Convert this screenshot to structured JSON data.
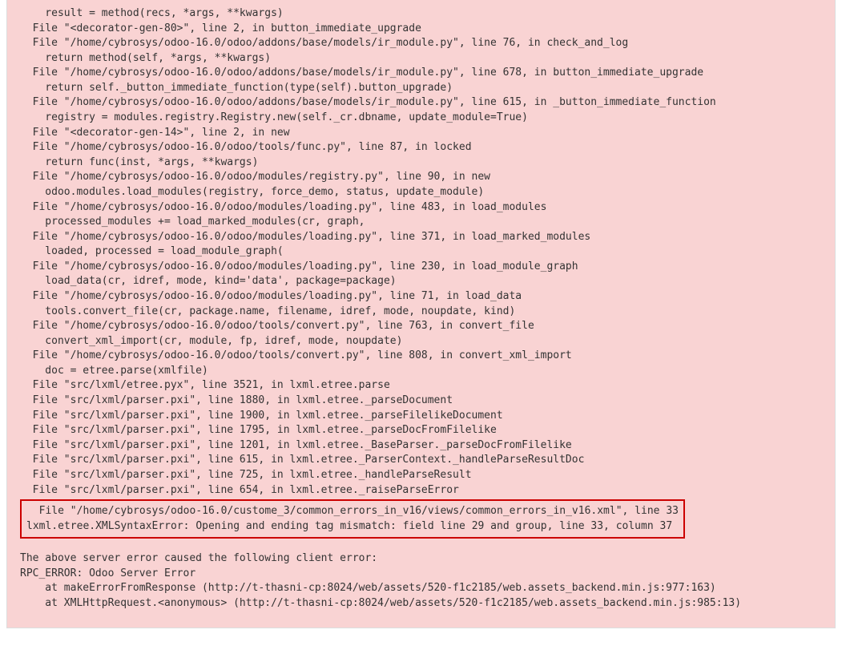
{
  "traceback": {
    "lines": [
      {
        "text": "    result = method(recs, *args, **kwargs)",
        "cls": "indent-1"
      },
      {
        "text": "  File \"<decorator-gen-80>\", line 2, in button_immediate_upgrade",
        "cls": ""
      },
      {
        "text": "  File \"/home/cybrosys/odoo-16.0/odoo/addons/base/models/ir_module.py\", line 76, in check_and_log",
        "cls": ""
      },
      {
        "text": "    return method(self, *args, **kwargs)",
        "cls": "indent-1"
      },
      {
        "text": "  File \"/home/cybrosys/odoo-16.0/odoo/addons/base/models/ir_module.py\", line 678, in button_immediate_upgrade",
        "cls": ""
      },
      {
        "text": "    return self._button_immediate_function(type(self).button_upgrade)",
        "cls": "indent-1"
      },
      {
        "text": "  File \"/home/cybrosys/odoo-16.0/odoo/addons/base/models/ir_module.py\", line 615, in _button_immediate_function",
        "cls": ""
      },
      {
        "text": "    registry = modules.registry.Registry.new(self._cr.dbname, update_module=True)",
        "cls": "indent-1"
      },
      {
        "text": "  File \"<decorator-gen-14>\", line 2, in new",
        "cls": ""
      },
      {
        "text": "  File \"/home/cybrosys/odoo-16.0/odoo/tools/func.py\", line 87, in locked",
        "cls": ""
      },
      {
        "text": "    return func(inst, *args, **kwargs)",
        "cls": "indent-1"
      },
      {
        "text": "  File \"/home/cybrosys/odoo-16.0/odoo/modules/registry.py\", line 90, in new",
        "cls": ""
      },
      {
        "text": "    odoo.modules.load_modules(registry, force_demo, status, update_module)",
        "cls": "indent-1"
      },
      {
        "text": "  File \"/home/cybrosys/odoo-16.0/odoo/modules/loading.py\", line 483, in load_modules",
        "cls": ""
      },
      {
        "text": "    processed_modules += load_marked_modules(cr, graph,",
        "cls": "indent-1"
      },
      {
        "text": "  File \"/home/cybrosys/odoo-16.0/odoo/modules/loading.py\", line 371, in load_marked_modules",
        "cls": ""
      },
      {
        "text": "    loaded, processed = load_module_graph(",
        "cls": "indent-1"
      },
      {
        "text": "  File \"/home/cybrosys/odoo-16.0/odoo/modules/loading.py\", line 230, in load_module_graph",
        "cls": ""
      },
      {
        "text": "    load_data(cr, idref, mode, kind='data', package=package)",
        "cls": "indent-1"
      },
      {
        "text": "  File \"/home/cybrosys/odoo-16.0/odoo/modules/loading.py\", line 71, in load_data",
        "cls": ""
      },
      {
        "text": "    tools.convert_file(cr, package.name, filename, idref, mode, noupdate, kind)",
        "cls": "indent-1"
      },
      {
        "text": "  File \"/home/cybrosys/odoo-16.0/odoo/tools/convert.py\", line 763, in convert_file",
        "cls": ""
      },
      {
        "text": "    convert_xml_import(cr, module, fp, idref, mode, noupdate)",
        "cls": "indent-1"
      },
      {
        "text": "  File \"/home/cybrosys/odoo-16.0/odoo/tools/convert.py\", line 808, in convert_xml_import",
        "cls": ""
      },
      {
        "text": "    doc = etree.parse(xmlfile)",
        "cls": "indent-1"
      },
      {
        "text": "  File \"src/lxml/etree.pyx\", line 3521, in lxml.etree.parse",
        "cls": ""
      },
      {
        "text": "  File \"src/lxml/parser.pxi\", line 1880, in lxml.etree._parseDocument",
        "cls": ""
      },
      {
        "text": "  File \"src/lxml/parser.pxi\", line 1900, in lxml.etree._parseFilelikeDocument",
        "cls": ""
      },
      {
        "text": "  File \"src/lxml/parser.pxi\", line 1795, in lxml.etree._parseDocFromFilelike",
        "cls": ""
      },
      {
        "text": "  File \"src/lxml/parser.pxi\", line 1201, in lxml.etree._BaseParser._parseDocFromFilelike",
        "cls": ""
      },
      {
        "text": "  File \"src/lxml/parser.pxi\", line 615, in lxml.etree._ParserContext._handleParseResultDoc",
        "cls": ""
      },
      {
        "text": "  File \"src/lxml/parser.pxi\", line 725, in lxml.etree._handleParseResult",
        "cls": ""
      },
      {
        "text": "  File \"src/lxml/parser.pxi\", line 654, in lxml.etree._raiseParseError",
        "cls": ""
      }
    ],
    "highlight": [
      "  File \"/home/cybrosys/odoo-16.0/custome_3/common_errors_in_v16/views/common_errors_in_v16.xml\", line 33",
      "lxml.etree.XMLSyntaxError: Opening and ending tag mismatch: field line 29 and group, line 33, column 37"
    ],
    "client_error": [
      "The above server error caused the following client error:",
      "RPC_ERROR: Odoo Server Error",
      "    at makeErrorFromResponse (http://t-thasni-cp:8024/web/assets/520-f1c2185/web.assets_backend.min.js:977:163)",
      "    at XMLHttpRequest.<anonymous> (http://t-thasni-cp:8024/web/assets/520-f1c2185/web.assets_backend.min.js:985:13)"
    ]
  }
}
